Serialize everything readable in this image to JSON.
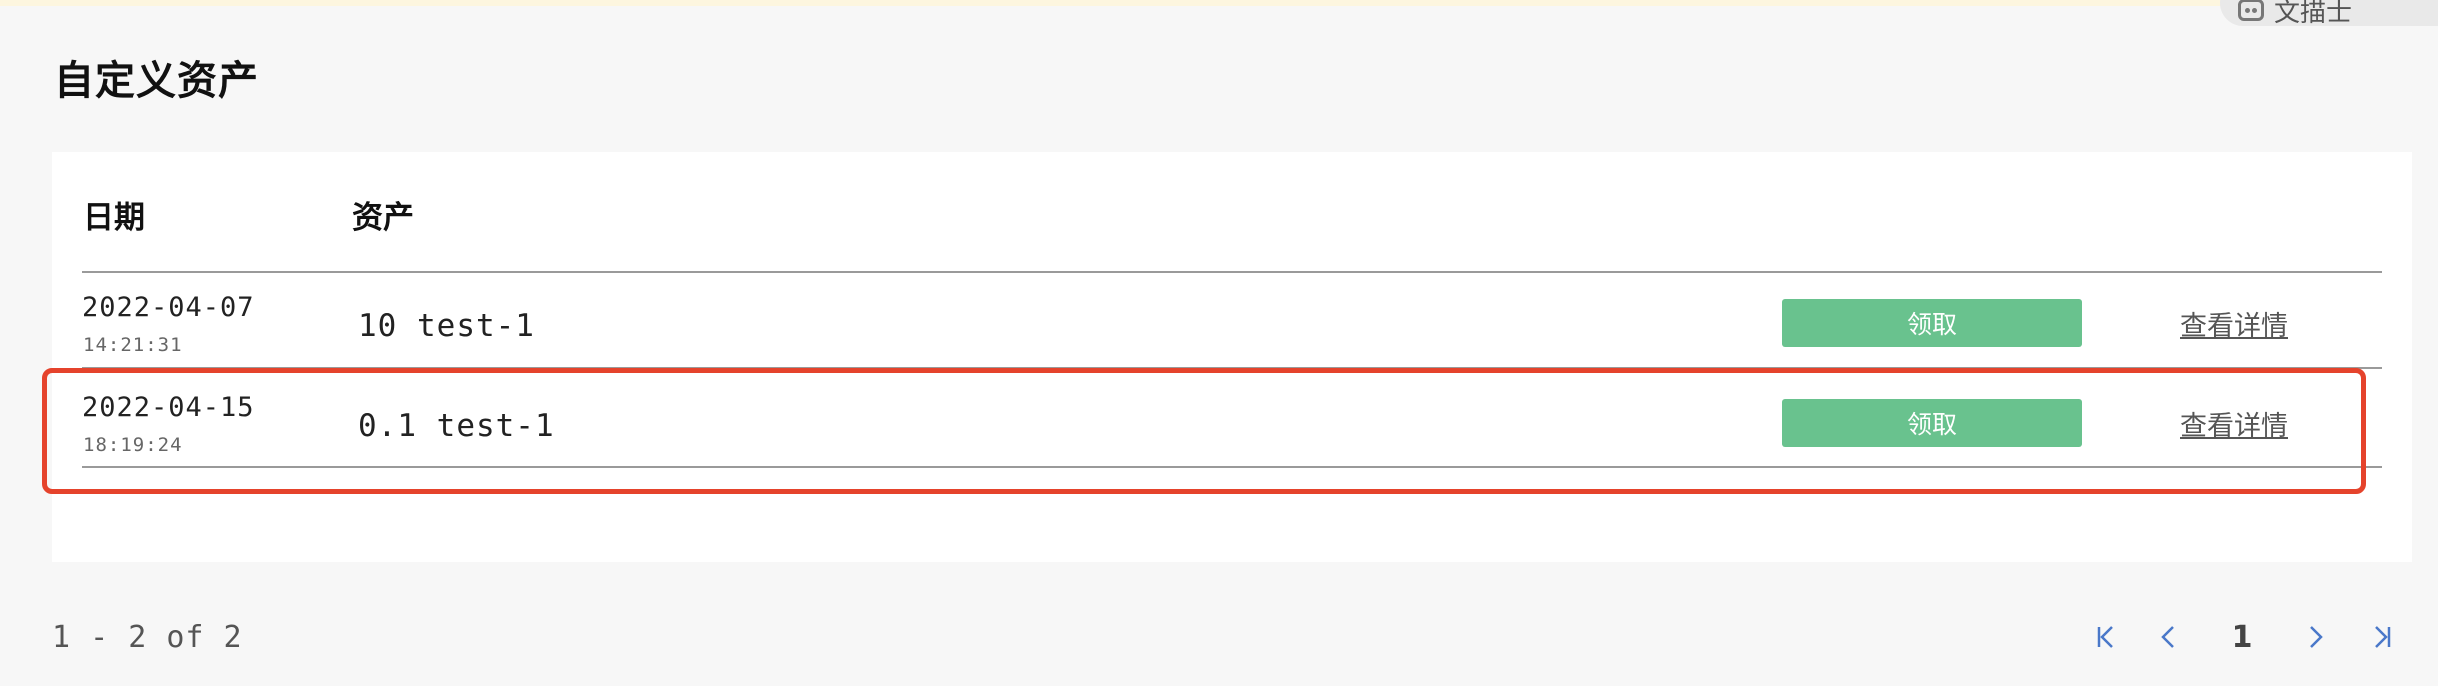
{
  "page": {
    "title": "自定义资产"
  },
  "corner_badge": {
    "icon": "robot-icon",
    "text": "文描士"
  },
  "table": {
    "headers": {
      "date": "日期",
      "asset": "资产"
    },
    "rows": [
      {
        "date": "2022-04-07",
        "time": "14:21:31",
        "asset": "10 test-1",
        "claim_label": "领取",
        "detail_label": "查看详情"
      },
      {
        "date": "2022-04-15",
        "time": "18:19:24",
        "asset": "0.1 test-1",
        "claim_label": "领取",
        "detail_label": "查看详情"
      }
    ]
  },
  "pagination": {
    "summary": "1 - 2 of 2",
    "current_page": "1",
    "icons": [
      "first-page-icon",
      "prev-page-icon",
      "next-page-icon",
      "last-page-icon"
    ]
  },
  "colors": {
    "accent_green": "#69c28e",
    "highlight_red": "#e5432c",
    "pager_blue": "#4a78c9"
  }
}
